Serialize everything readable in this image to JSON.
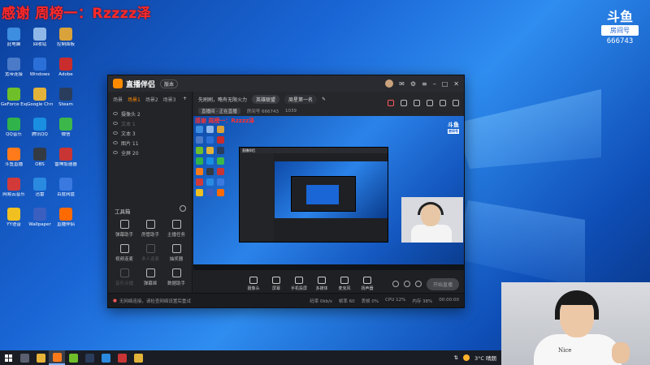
{
  "overlay": {
    "banner": "感谢 周榜一：Rzzzz泽",
    "douyu_mark": "斗鱼",
    "douyu_tag": "房间号",
    "room_id": "666743"
  },
  "desktop_icons": [
    {
      "label": "此电脑",
      "color": "#3d8de0"
    },
    {
      "label": "回收站",
      "color": "#8fb8e8"
    },
    {
      "label": "控制面板",
      "color": "#d9a23a"
    },
    {
      "label": "宽带连接",
      "color": "#4a7ac8"
    },
    {
      "label": "Windows",
      "color": "#2b70d8"
    },
    {
      "label": "Adobe",
      "color": "#c92c2c"
    },
    {
      "label": "GeForce Experience",
      "color": "#6fbf2b"
    },
    {
      "label": "Google Chrome",
      "color": "#e2b33a"
    },
    {
      "label": "Steam",
      "color": "#2a3d5c"
    },
    {
      "label": "QQ音乐",
      "color": "#2fb34a"
    },
    {
      "label": "腾讯QQ",
      "color": "#1a8ee0"
    },
    {
      "label": "微信",
      "color": "#3cb84a"
    },
    {
      "label": "斗鱼直播",
      "color": "#ff7a1a"
    },
    {
      "label": "OBS",
      "color": "#333a44"
    },
    {
      "label": "雷神加速器",
      "color": "#c93535"
    },
    {
      "label": "网易云音乐",
      "color": "#d23a3a"
    },
    {
      "label": "迅雷",
      "color": "#2a8ae0"
    },
    {
      "label": "百度网盘",
      "color": "#3a7ae0"
    },
    {
      "label": "YY语音",
      "color": "#f0c020"
    },
    {
      "label": "Wallpaper",
      "color": "#3a5fc0"
    },
    {
      "label": "直播伴侣",
      "color": "#ff6a00"
    }
  ],
  "app": {
    "title": "直播伴侣",
    "version": "版本",
    "scene_tabs": [
      "场景",
      "场景1",
      "场景2",
      "场景3"
    ],
    "sources": [
      {
        "label": "摄像头 2",
        "dim": false
      },
      {
        "label": "文本 1",
        "dim": true
      },
      {
        "label": "文本 3",
        "dim": false
      },
      {
        "label": "图片 11",
        "dim": false
      },
      {
        "label": "全屏 20",
        "dim": false
      }
    ],
    "tools_title": "工具箱",
    "tools": [
      {
        "label": "弹幕助手",
        "dim": false
      },
      {
        "label": "房管助手",
        "dim": false
      },
      {
        "label": "主播任务",
        "dim": false
      },
      {
        "label": "视频连麦",
        "dim": false
      },
      {
        "label": "多人连麦",
        "dim": true
      },
      {
        "label": "抽奖器",
        "dim": false
      },
      {
        "label": "音乐点播",
        "dim": true
      },
      {
        "label": "弹幕姬",
        "dim": false
      },
      {
        "label": "数据助手",
        "dim": false
      }
    ],
    "infobar": {
      "title": "先刷刷，略有无限火力",
      "category": "英雄联盟",
      "extra": "周星第一名"
    },
    "metabar": {
      "room_tag": "直播间 · 正在直播",
      "room_label": "房间号 666743",
      "hot": "1039"
    },
    "preview_banner": "感谢 周榜一：Rzzzz泽",
    "bottom_actions": [
      "摄像头",
      "屏幕",
      "手机投屏",
      "多媒体",
      "麦克风",
      "扬声器"
    ],
    "start_live": "开始直播",
    "status_warn": "无网络连接，请检查网络设置后重试",
    "stats": [
      "码率 0kb/s",
      "帧率 60",
      "丢帧 0%",
      "CPU 12%",
      "内存 38%",
      "00:00:00"
    ]
  },
  "webcam": {
    "shirt_text": "Nice"
  },
  "taskbar": {
    "apps": [
      {
        "name": "search-app",
        "color": "#5a6070"
      },
      {
        "name": "folder-app",
        "color": "#e8b33a"
      },
      {
        "name": "douyu-app",
        "color": "#ff7a1a",
        "active": true
      },
      {
        "name": "game-app",
        "color": "#6fbf2b"
      },
      {
        "name": "steam-app",
        "color": "#2a3d5c"
      },
      {
        "name": "settings-app",
        "color": "#2a8ae0"
      },
      {
        "name": "store-app",
        "color": "#c93535"
      },
      {
        "name": "chrome-app",
        "color": "#e2b33a"
      }
    ],
    "weather": "3°C 晴朗"
  }
}
